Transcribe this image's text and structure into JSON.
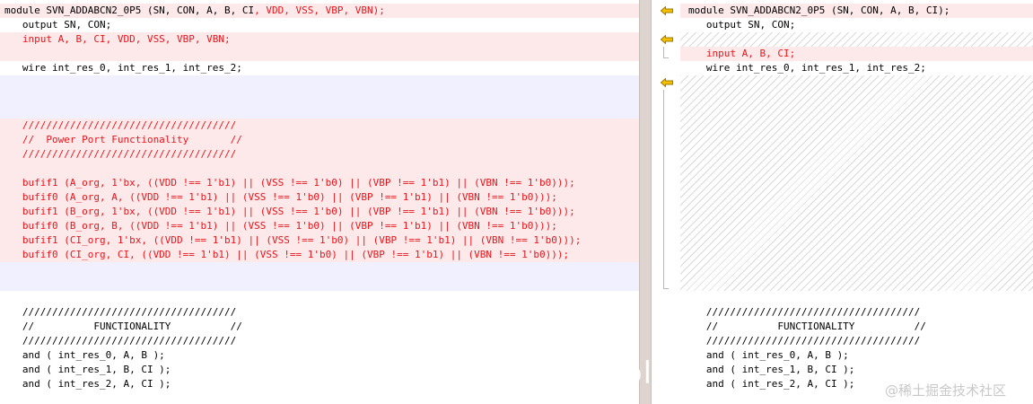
{
  "left": {
    "lines": [
      {
        "segments": [
          {
            "text": "module SVN_ADDABCN2_0P5 (SN, CON, A, B, CI",
            "color": "black"
          },
          {
            "text": ", VDD, VSS, VBP, VBN);",
            "color": "red"
          }
        ]
      },
      {
        "segments": [
          {
            "text": "   output SN, CON;",
            "color": "black"
          }
        ]
      },
      {
        "segments": [
          {
            "text": "   input A, B, CI, VDD, VSS, VBP, VBN;",
            "color": "red"
          }
        ]
      },
      {
        "segments": [
          {
            "text": "",
            "color": "black"
          }
        ]
      },
      {
        "segments": [
          {
            "text": "   wire int_res_0, int_res_1, int_res_2;",
            "color": "black"
          }
        ]
      },
      {
        "segments": [
          {
            "text": "",
            "color": "black"
          }
        ]
      },
      {
        "segments": [
          {
            "text": "",
            "color": "black"
          }
        ]
      },
      {
        "segments": [
          {
            "text": "",
            "color": "black"
          }
        ]
      },
      {
        "segments": [
          {
            "text": "   ////////////////////////////////////",
            "color": "red"
          }
        ]
      },
      {
        "segments": [
          {
            "text": "   //  Power Port Functionality       //",
            "color": "red"
          }
        ]
      },
      {
        "segments": [
          {
            "text": "   ////////////////////////////////////",
            "color": "red"
          }
        ]
      },
      {
        "segments": [
          {
            "text": "",
            "color": "black"
          }
        ]
      },
      {
        "segments": [
          {
            "text": "   bufif1 (A_org, 1'bx, ((VDD !== 1'b1) || (VSS !== 1'b0) || (VBP !== 1'b1) || (VBN !== 1'b0)));",
            "color": "red"
          }
        ]
      },
      {
        "segments": [
          {
            "text": "   bufif0 (A_org, A, ((VDD !== 1'b1) || (VSS !== 1'b0) || (VBP !== 1'b1) || (VBN !== 1'b0)));",
            "color": "red"
          }
        ]
      },
      {
        "segments": [
          {
            "text": "   bufif1 (B_org, 1'bx, ((VDD !== 1'b1) || (VSS !== 1'b0) || (VBP !== 1'b1) || (VBN !== 1'b0)));",
            "color": "red"
          }
        ]
      },
      {
        "segments": [
          {
            "text": "   bufif0 (B_org, B, ((VDD !== 1'b1) || (VSS !== 1'b0) || (VBP !== 1'b1) || (VBN !== 1'b0)));",
            "color": "red"
          }
        ]
      },
      {
        "segments": [
          {
            "text": "   bufif1 (CI_org, 1'bx, ((VDD !== 1'b1) || (VSS !== 1'b0) || (VBP !== 1'b1) || (VBN !== 1'b0)));",
            "color": "red"
          }
        ]
      },
      {
        "segments": [
          {
            "text": "   bufif0 (CI_org, CI, ((VDD !== 1'b1) || (VSS !== 1'b0) || (VBP !== 1'b1) || (VBN !== 1'b0)));",
            "color": "red"
          }
        ]
      },
      {
        "segments": [
          {
            "text": "",
            "color": "black"
          }
        ]
      },
      {
        "segments": [
          {
            "text": "",
            "color": "black"
          }
        ]
      },
      {
        "segments": [
          {
            "text": "",
            "color": "black"
          }
        ]
      },
      {
        "segments": [
          {
            "text": "   ////////////////////////////////////",
            "color": "black"
          }
        ]
      },
      {
        "segments": [
          {
            "text": "   //          FUNCTIONALITY          //",
            "color": "black"
          }
        ]
      },
      {
        "segments": [
          {
            "text": "   ////////////////////////////////////",
            "color": "black"
          }
        ]
      },
      {
        "segments": [
          {
            "text": "   and ( int_res_0, A, B );",
            "color": "black"
          }
        ]
      },
      {
        "segments": [
          {
            "text": "   and ( int_res_1, B, CI );",
            "color": "black"
          }
        ]
      },
      {
        "segments": [
          {
            "text": "   and ( int_res_2, A, CI );",
            "color": "black"
          }
        ]
      }
    ]
  },
  "right": {
    "lines": [
      {
        "segments": [
          {
            "text": "module SVN_ADDABCN2_0P5 (SN, CON, A, B, CI);",
            "color": "black"
          }
        ]
      },
      {
        "segments": [
          {
            "text": "   output SN, CON;",
            "color": "black"
          }
        ]
      },
      {
        "segments": [
          {
            "text": "",
            "color": "black"
          }
        ]
      },
      {
        "segments": [
          {
            "text": "   input A, B, CI;",
            "color": "red"
          }
        ]
      },
      {
        "segments": [
          {
            "text": "   wire int_res_0, int_res_1, int_res_2;",
            "color": "black"
          }
        ]
      },
      {
        "segments": [
          {
            "text": "",
            "color": "black"
          }
        ]
      },
      {
        "segments": [
          {
            "text": "",
            "color": "black"
          }
        ]
      },
      {
        "segments": [
          {
            "text": "",
            "color": "black"
          }
        ]
      },
      {
        "segments": [
          {
            "text": "",
            "color": "black"
          }
        ]
      },
      {
        "segments": [
          {
            "text": "",
            "color": "black"
          }
        ]
      },
      {
        "segments": [
          {
            "text": "",
            "color": "black"
          }
        ]
      },
      {
        "segments": [
          {
            "text": "",
            "color": "black"
          }
        ]
      },
      {
        "segments": [
          {
            "text": "",
            "color": "black"
          }
        ]
      },
      {
        "segments": [
          {
            "text": "",
            "color": "black"
          }
        ]
      },
      {
        "segments": [
          {
            "text": "",
            "color": "black"
          }
        ]
      },
      {
        "segments": [
          {
            "text": "",
            "color": "black"
          }
        ]
      },
      {
        "segments": [
          {
            "text": "",
            "color": "black"
          }
        ]
      },
      {
        "segments": [
          {
            "text": "",
            "color": "black"
          }
        ]
      },
      {
        "segments": [
          {
            "text": "",
            "color": "black"
          }
        ]
      },
      {
        "segments": [
          {
            "text": "",
            "color": "black"
          }
        ]
      },
      {
        "segments": [
          {
            "text": "",
            "color": "black"
          }
        ]
      },
      {
        "segments": [
          {
            "text": "   ////////////////////////////////////",
            "color": "black"
          }
        ]
      },
      {
        "segments": [
          {
            "text": "   //          FUNCTIONALITY          //",
            "color": "black"
          }
        ]
      },
      {
        "segments": [
          {
            "text": "   ////////////////////////////////////",
            "color": "black"
          }
        ]
      },
      {
        "segments": [
          {
            "text": "   and ( int_res_0, A, B );",
            "color": "black"
          }
        ]
      },
      {
        "segments": [
          {
            "text": "   and ( int_res_1, B, CI );",
            "color": "black"
          }
        ]
      },
      {
        "segments": [
          {
            "text": "   and ( int_res_2, A, CI );",
            "color": "black"
          }
        ]
      }
    ]
  },
  "gutter": {
    "arrow_icons": [
      "merge-left-arrow-icon",
      "merge-left-arrow-icon",
      "merge-left-arrow-icon"
    ]
  },
  "colors": {
    "changed_text": "#e8161b",
    "changed_line_bg": "#fde8ea",
    "filler_bg": "#f1f0ff",
    "arrow_fill": "#f2c200",
    "arrow_stroke": "#a07800"
  },
  "watermark": {
    "overlay_text": "blog",
    "site_text": "@稀土掘金技术社区"
  }
}
